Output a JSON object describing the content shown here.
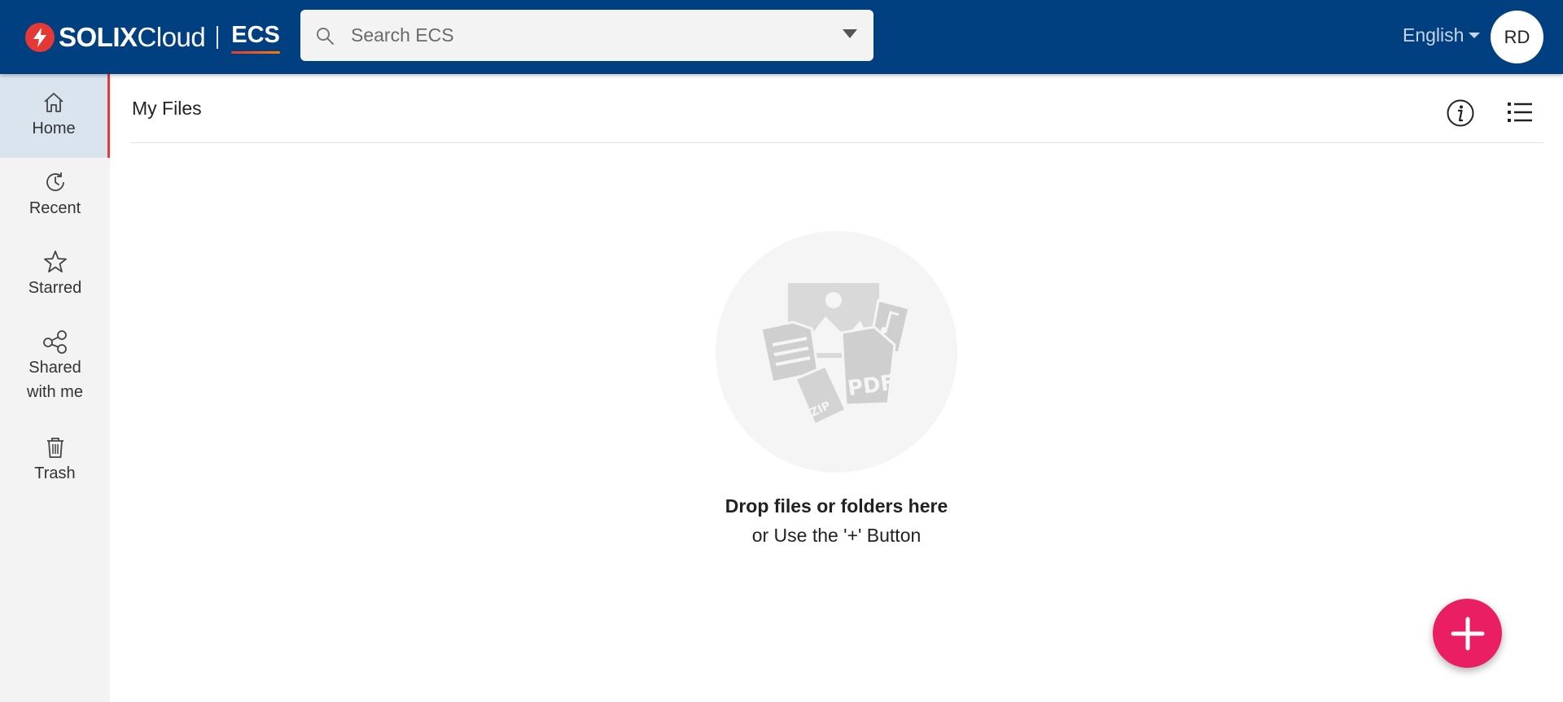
{
  "header": {
    "brand_bold": "SOLIX",
    "brand_light": "Cloud",
    "product": "ECS",
    "search_placeholder": "Search ECS",
    "language": "English",
    "avatar_initials": "RD"
  },
  "sidebar": {
    "items": [
      {
        "label": "Home",
        "icon": "home-icon",
        "active": true
      },
      {
        "label": "Recent",
        "icon": "recent-icon",
        "active": false
      },
      {
        "label": "Starred",
        "icon": "star-icon",
        "active": false
      },
      {
        "label": "Shared with me",
        "icon": "share-icon",
        "active": false
      },
      {
        "label": "Trash",
        "icon": "trash-icon",
        "active": false
      }
    ]
  },
  "main": {
    "title": "My Files",
    "empty_title": "Drop files or folders here",
    "empty_subtitle": "or Use the '+' Button"
  },
  "colors": {
    "header_bg": "#003f80",
    "accent": "#e53935",
    "fab": "#e91e63",
    "sidebar_bg": "#f3f3f3",
    "active_bg": "#d9e4ef"
  }
}
